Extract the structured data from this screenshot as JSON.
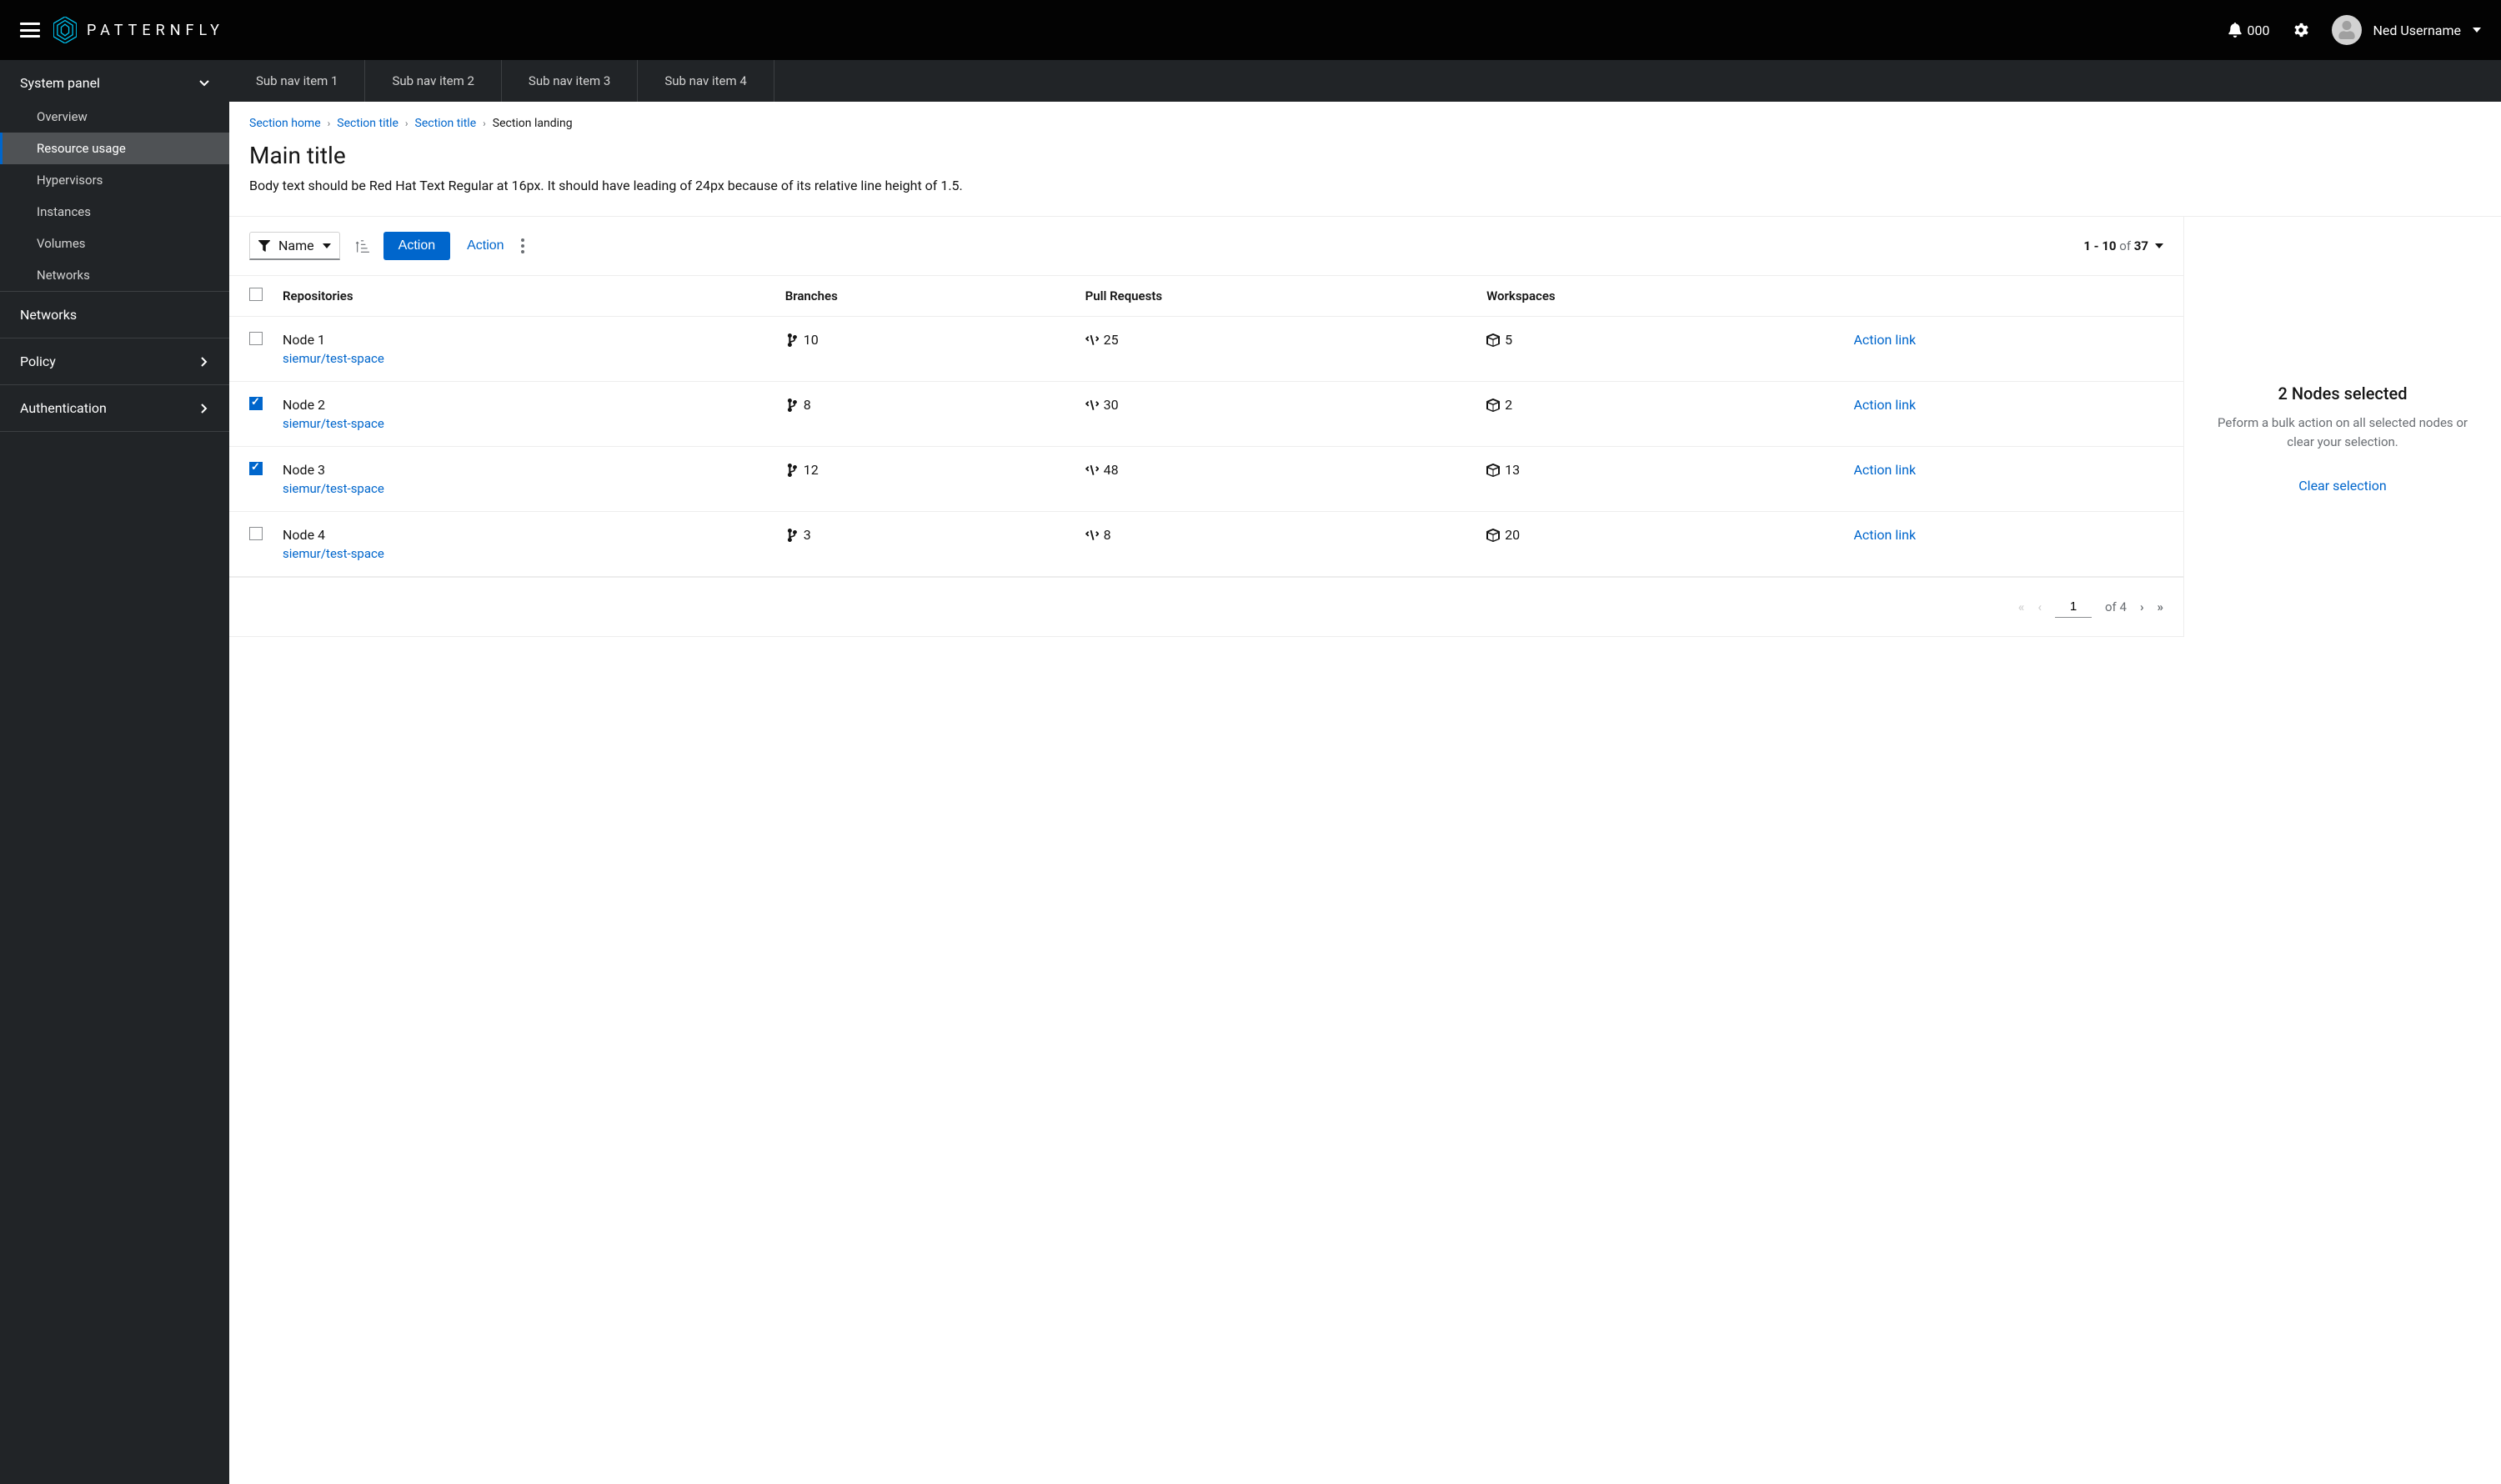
{
  "masthead": {
    "brand": "PATTERNFLY",
    "notif_count": "000",
    "username": "Ned Username"
  },
  "sidebar": {
    "group_label": "System panel",
    "items": [
      {
        "label": "Overview"
      },
      {
        "label": "Resource usage"
      },
      {
        "label": "Hypervisors"
      },
      {
        "label": "Instances"
      },
      {
        "label": "Volumes"
      },
      {
        "label": "Networks"
      }
    ],
    "top_items": [
      {
        "label": "Networks",
        "expandable": false
      },
      {
        "label": "Policy",
        "expandable": true
      },
      {
        "label": "Authentication",
        "expandable": true
      }
    ]
  },
  "subnav": [
    {
      "label": "Sub nav item 1"
    },
    {
      "label": "Sub nav item 2"
    },
    {
      "label": "Sub nav item 3"
    },
    {
      "label": "Sub nav item 4"
    }
  ],
  "breadcrumb": [
    {
      "label": "Section home",
      "link": true
    },
    {
      "label": "Section title",
      "link": true
    },
    {
      "label": "Section title",
      "link": true
    },
    {
      "label": "Section landing",
      "link": false
    }
  ],
  "header": {
    "title": "Main title",
    "body": "Body text should be Red Hat Text Regular at 16px. It should have leading of 24px because of its relative line height of 1.5."
  },
  "toolbar": {
    "filter_label": "Name",
    "primary_action": "Action",
    "secondary_action": "Action",
    "range_prefix": "1 - 10",
    "range_of": "of",
    "range_total": "37"
  },
  "table": {
    "columns": [
      "Repositories",
      "Branches",
      "Pull Requests",
      "Workspaces",
      ""
    ],
    "rows": [
      {
        "checked": false,
        "name": "Node 1",
        "sub": "siemur/test-space",
        "branches": "10",
        "prs": "25",
        "ws": "5",
        "action": "Action link"
      },
      {
        "checked": true,
        "name": "Node 2",
        "sub": "siemur/test-space",
        "branches": "8",
        "prs": "30",
        "ws": "2",
        "action": "Action link"
      },
      {
        "checked": true,
        "name": "Node 3",
        "sub": "siemur/test-space",
        "branches": "12",
        "prs": "48",
        "ws": "13",
        "action": "Action link"
      },
      {
        "checked": false,
        "name": "Node 4",
        "sub": "siemur/test-space",
        "branches": "3",
        "prs": "8",
        "ws": "20",
        "action": "Action link"
      }
    ]
  },
  "pagination": {
    "page": "1",
    "of_label": "of",
    "total": "4"
  },
  "side_panel": {
    "title": "2 Nodes selected",
    "desc": "Peform a bulk action on all selected nodes or clear your selection.",
    "clear": "Clear selection"
  }
}
